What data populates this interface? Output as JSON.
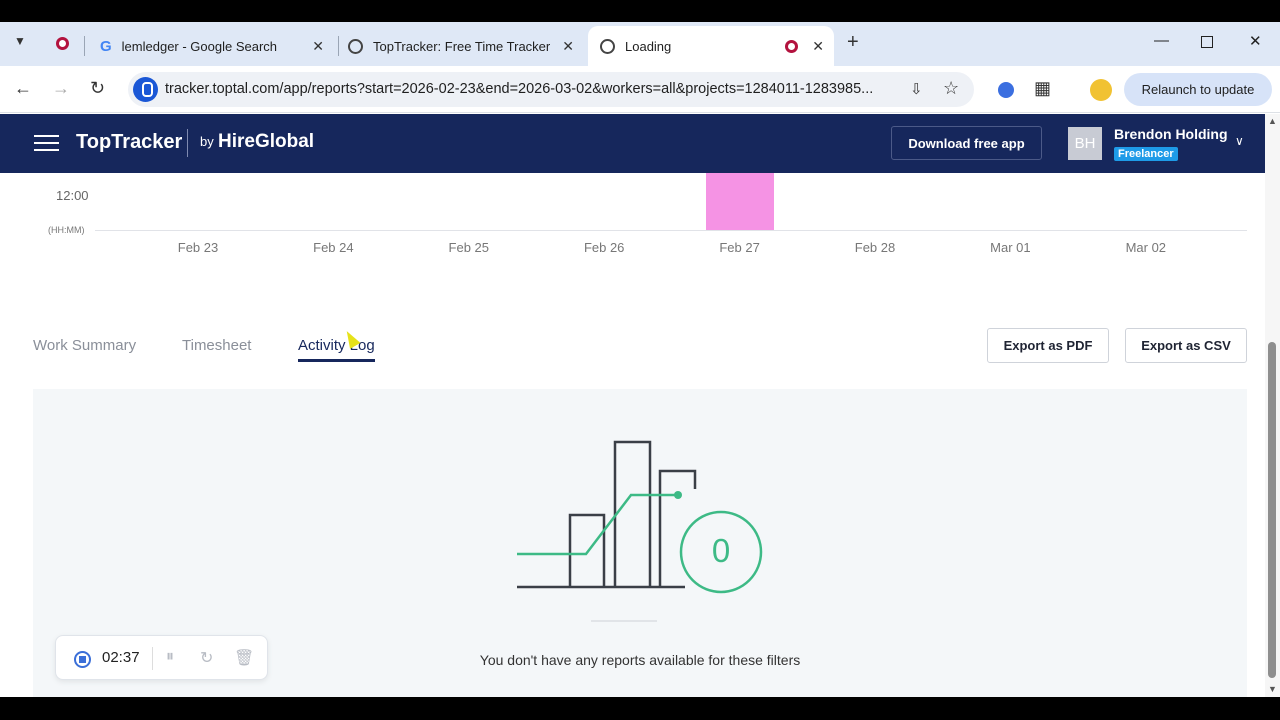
{
  "browser": {
    "tabs": [
      {
        "label": "lemledger - Google Search",
        "icon": "google-icon"
      },
      {
        "label": "TopTracker: Free Time Tracker",
        "icon": "stopwatch-icon"
      },
      {
        "label": "Loading",
        "icon": "stopwatch-icon"
      }
    ],
    "url": "tracker.toptal.com/app/reports?start=2026-02-23&end=2026-03-02&workers=all&projects=1284011-1283985...",
    "relaunch_label": "Relaunch to update"
  },
  "app": {
    "brand": "TopTracker",
    "by": "by",
    "partner": "HireGlobal",
    "download_label": "Download free app",
    "user": {
      "initials": "BH",
      "name": "Brendon Holding",
      "role": "Freelancer"
    }
  },
  "chart_data": {
    "type": "bar",
    "categories": [
      "Feb 23",
      "Feb 24",
      "Feb 25",
      "Feb 26",
      "Feb 27",
      "Feb 28",
      "Mar 01",
      "Mar 02"
    ],
    "y_tick": "12:00",
    "y_unit": "(HH:MM)",
    "highlight_color": "#f593e4"
  },
  "report": {
    "tabs": [
      "Work Summary",
      "Timesheet",
      "Activity Log"
    ],
    "active_tab": "Activity Log",
    "export_pdf": "Export as PDF",
    "export_csv": "Export as CSV",
    "zero_count": "0",
    "empty_message": "You don't have any reports available for these filters"
  },
  "timer": {
    "time": "02:37"
  },
  "colors": {
    "header_bg": "#16275c",
    "accent_green": "#3dba86",
    "badge": "#1e9be8"
  }
}
